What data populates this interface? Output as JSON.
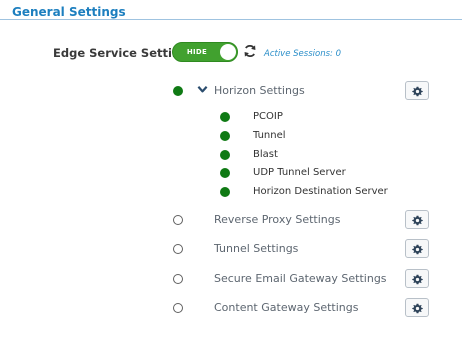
{
  "section": {
    "title": "General Settings"
  },
  "edge_service": {
    "label": "Edge Service Settings",
    "toggle_label": "HIDE",
    "active_sessions": "Active Sessions: 0"
  },
  "settings": [
    {
      "label": "Horizon Settings",
      "enabled": true,
      "expanded": true,
      "sub_items": [
        "PCOIP",
        "Tunnel",
        "Blast",
        "UDP Tunnel Server",
        "Horizon Destination Server"
      ]
    },
    {
      "label": "Reverse Proxy Settings",
      "enabled": false
    },
    {
      "label": "Tunnel Settings",
      "enabled": false
    },
    {
      "label": "Secure Email Gateway Settings",
      "enabled": false
    },
    {
      "label": "Content Gateway Settings",
      "enabled": false
    }
  ],
  "colors": {
    "accent": "#1d7fbf",
    "toggle_on": "#41a12f",
    "status_on": "#0f7a14",
    "label_gray": "#5d6670"
  },
  "icons": [
    "refresh-icon",
    "chevron-down-icon",
    "gear-icon"
  ]
}
